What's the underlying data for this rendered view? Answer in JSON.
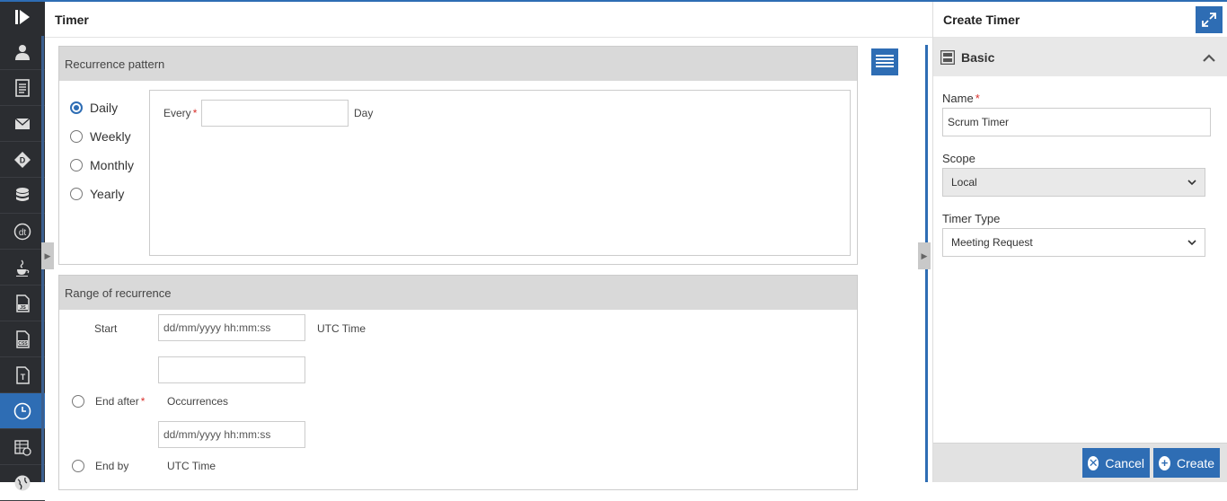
{
  "main": {
    "title": "Timer",
    "recurrence": {
      "heading": "Recurrence pattern",
      "options": [
        "Daily",
        "Weekly",
        "Monthly",
        "Yearly"
      ],
      "selected": "Daily",
      "every_label": "Every",
      "every_value": "",
      "unit_label": "Day"
    },
    "range": {
      "heading": "Range of recurrence",
      "start_label": "Start",
      "start_placeholder": "dd/mm/yyyy hh:mm:ss",
      "start_tz": "UTC Time",
      "end_after_label": "End after",
      "occurrences_label": "Occurrences",
      "end_by_placeholder": "dd/mm/yyyy hh:mm:ss",
      "end_by_label": "End by",
      "end_by_tz": "UTC Time"
    }
  },
  "panel": {
    "title": "Create Timer",
    "section": "Basic",
    "name_label": "Name",
    "name_value": "Scrum Timer",
    "scope_label": "Scope",
    "scope_value": "Local",
    "type_label": "Timer Type",
    "type_value": "Meeting Request",
    "cancel_label": "Cancel",
    "create_label": "Create"
  },
  "rail_icons": [
    "user-icon",
    "document-icon",
    "mail-icon",
    "diamond-icon",
    "database-icon",
    "dt-icon",
    "java-icon",
    "js-file-icon",
    "css-file-icon",
    "text-file-icon",
    "clock-icon",
    "spreadsheet-icon",
    "globe-icon"
  ],
  "colors": {
    "accent": "#2e6db4",
    "rail": "#2b2d31",
    "required": "#d9302c"
  }
}
